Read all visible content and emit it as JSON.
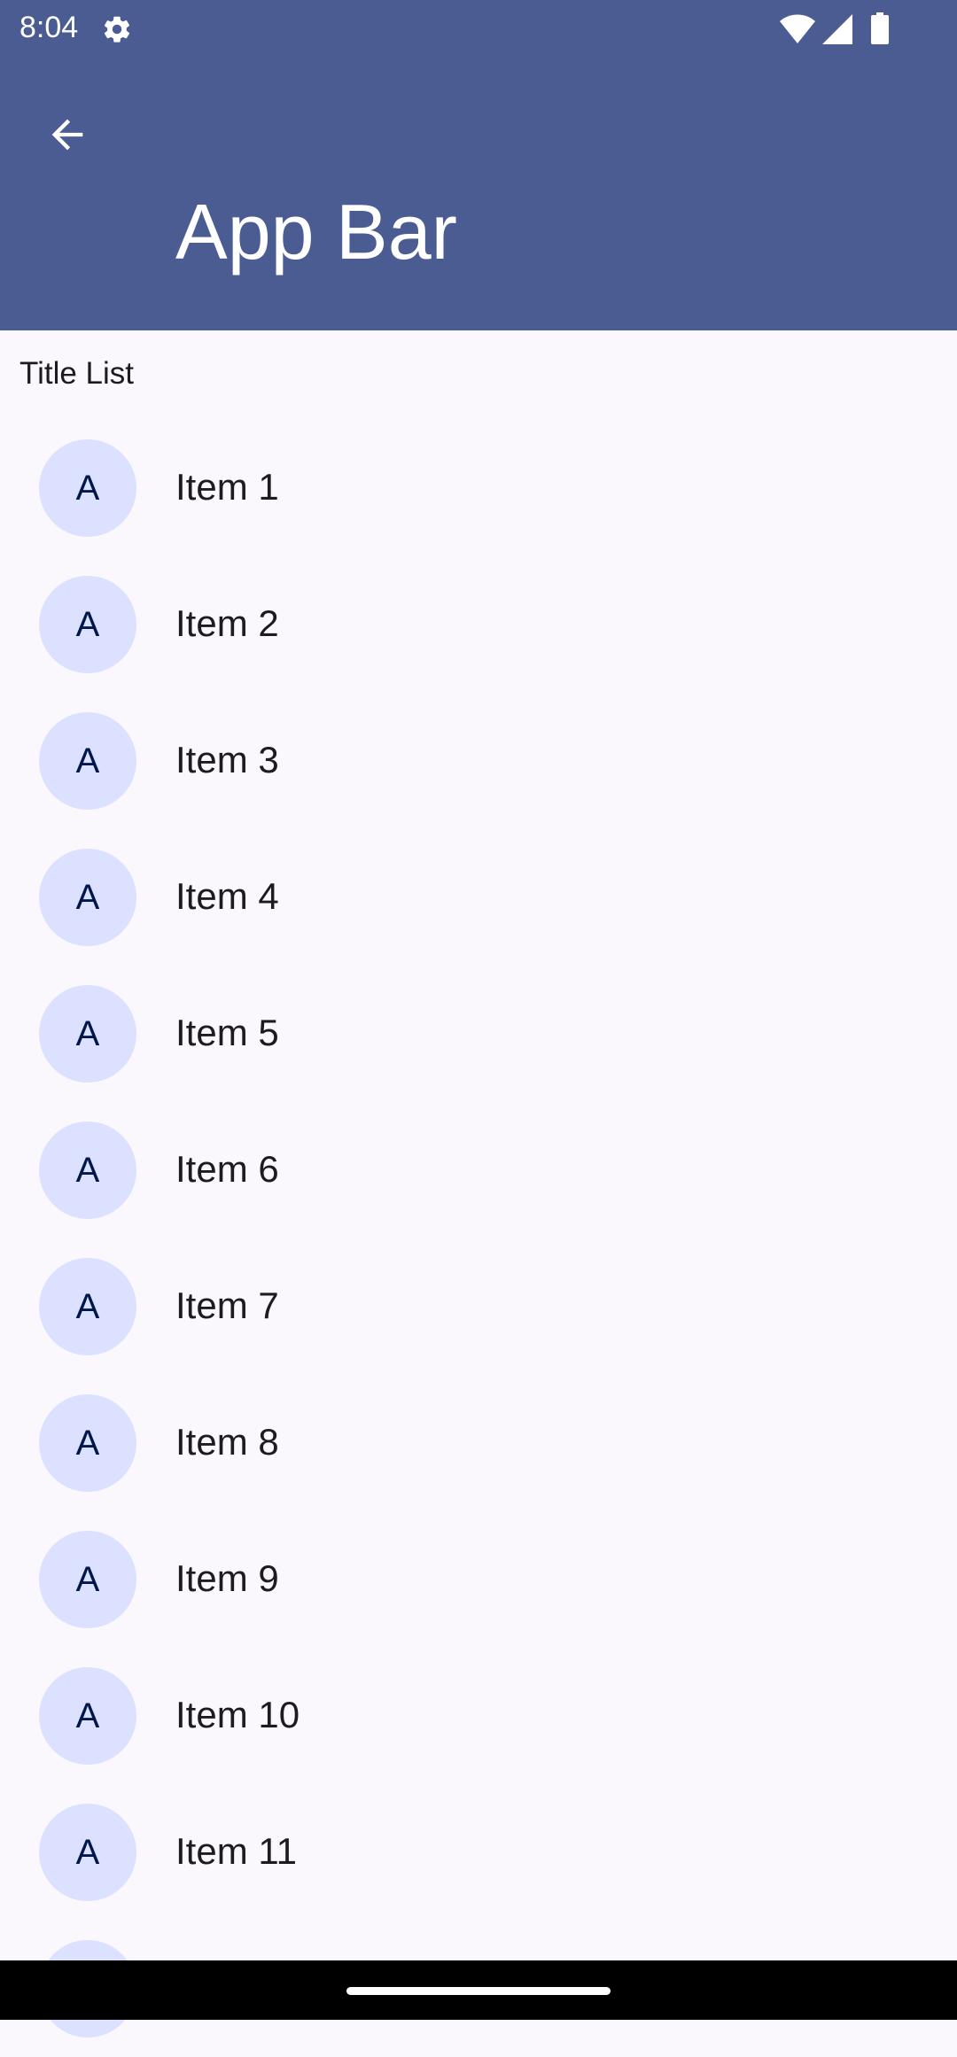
{
  "status_bar": {
    "time": "8:04",
    "icons": [
      "gear-icon",
      "wifi-icon",
      "signal-icon",
      "battery-icon"
    ]
  },
  "app_bar": {
    "title": "App Bar",
    "back_icon": "arrow-back-icon",
    "background": "#4A5C92"
  },
  "section": {
    "title": "Title List"
  },
  "list": {
    "avatar_color": "#DBE1FF",
    "items": [
      {
        "avatar": "A",
        "label": "Item 1"
      },
      {
        "avatar": "A",
        "label": "Item 2"
      },
      {
        "avatar": "A",
        "label": "Item 3"
      },
      {
        "avatar": "A",
        "label": "Item 4"
      },
      {
        "avatar": "A",
        "label": "Item 5"
      },
      {
        "avatar": "A",
        "label": "Item 6"
      },
      {
        "avatar": "A",
        "label": "Item 7"
      },
      {
        "avatar": "A",
        "label": "Item 8"
      },
      {
        "avatar": "A",
        "label": "Item 9"
      },
      {
        "avatar": "A",
        "label": "Item 10"
      },
      {
        "avatar": "A",
        "label": "Item 11"
      }
    ]
  }
}
